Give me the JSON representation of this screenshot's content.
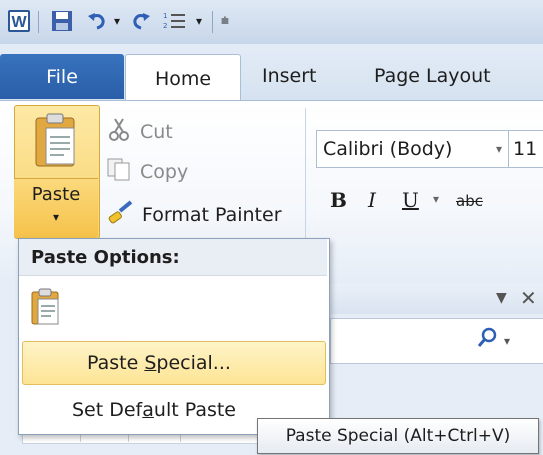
{
  "quick_access": {
    "icons": [
      "word-app-icon",
      "save-icon",
      "undo-icon",
      "redo-icon",
      "numbering-icon"
    ]
  },
  "tabs": [
    "File",
    "Home",
    "Insert",
    "Page Layout"
  ],
  "clipboard": {
    "paste_label": "Paste",
    "cut_label": "Cut",
    "copy_label": "Copy",
    "format_painter_label": "Format Painter"
  },
  "font": {
    "name": "Calibri (Body)",
    "size": "11",
    "bold": "B",
    "italic": "I",
    "underline": "U",
    "strike": "abc"
  },
  "paste_menu": {
    "header": "Paste Options:",
    "special_pre": "Paste ",
    "special_accel": "S",
    "special_post": "pecial...",
    "default_pre": "Set Def",
    "default_accel": "a",
    "default_post": "ult Paste"
  },
  "tooltip": "Paste Special (Alt+Ctrl+V)",
  "colors": {
    "file_tab": "#2a5ea8",
    "highlight": "#fde495",
    "ribbon_bg": "#f5f8fc"
  }
}
